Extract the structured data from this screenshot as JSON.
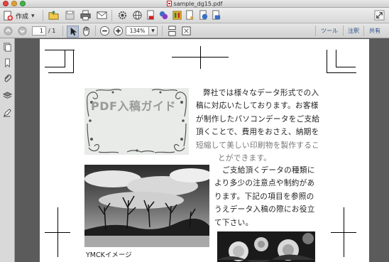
{
  "window": {
    "title": "sample_dg15.pdf"
  },
  "toolbar": {
    "create_label": "作成",
    "icons": [
      "open-folder-icon",
      "save-icon",
      "print-icon",
      "email-icon",
      "settings-icon",
      "globe-icon",
      "create-pdf-icon",
      "combine-icon",
      "edit-icon",
      "export-icon",
      "stamp-icon",
      "share-icon",
      "fullscreen-icon"
    ]
  },
  "nav": {
    "current_page": "1",
    "page_total": "/ 1",
    "zoom": "134%"
  },
  "right_links": {
    "tools": "ツール",
    "comment": "注釈",
    "share": "共有"
  },
  "document": {
    "logo_title": "PDF入稿ガイド",
    "para1": [
      "弊社では様々なデータ形式での入",
      "稿に対応いたしております。お客様",
      "が制作したパソコンデータをご支給",
      "頂くことで、費用をおさえ、納期を",
      "短縮して美しい印刷物を製作するこ",
      "とができます。"
    ],
    "para2": [
      "ご支給頂くデータの種類に",
      "より多少の注意点や制約があ",
      "ります。下記の項目を参照の",
      "うえデータ入稿の際にお役立",
      "て下さい。"
    ],
    "caption": "YMCKイメージ"
  },
  "colors": {
    "link": "#2a4f8a",
    "pdf_red": "#c22222"
  }
}
